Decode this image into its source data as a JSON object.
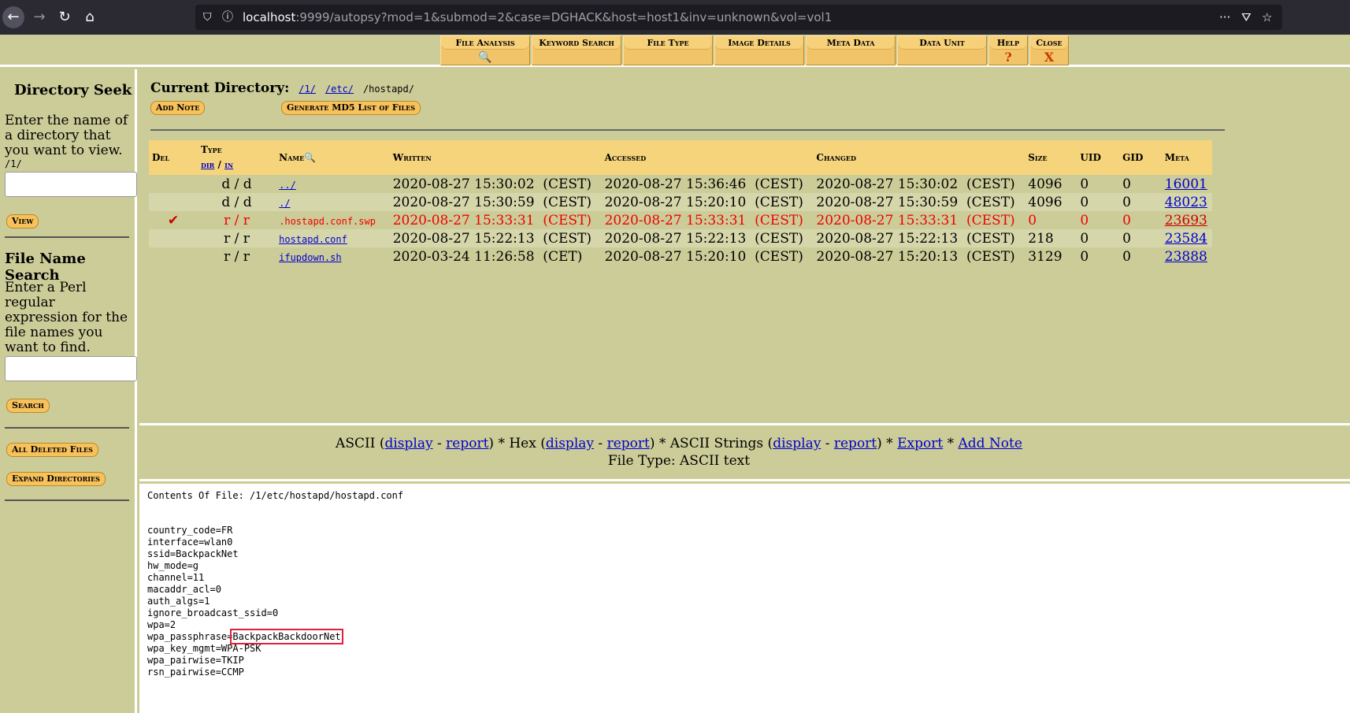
{
  "browser": {
    "url_host": "localhost",
    "url_rest": ":9999/autopsy?mod=1&submod=2&case=DGHACK&host=host1&inv=unknown&vol=vol1"
  },
  "menu": [
    {
      "label": "File Analysis",
      "sub": "🔍"
    },
    {
      "label": "Keyword Search",
      "sub": ""
    },
    {
      "label": "File Type",
      "sub": ""
    },
    {
      "label": "Image Details",
      "sub": ""
    },
    {
      "label": "Meta Data",
      "sub": ""
    },
    {
      "label": "Data Unit",
      "sub": ""
    },
    {
      "label": "Help",
      "sub": "?"
    },
    {
      "label": "Close",
      "sub": "X"
    }
  ],
  "sidebar": {
    "dir_seek_title": "Directory Seek",
    "dir_seek_text": "Enter the name of a directory that you want to view.",
    "dir_seek_path": "/1/",
    "view_label": "View",
    "file_search_title": "File Name Search",
    "file_search_text": "Enter a Perl regular expression for the file names you want to find.",
    "search_label": "Search",
    "all_deleted_label": "All Deleted Files",
    "expand_label": "Expand Directories"
  },
  "current_dir": {
    "label": "Current Directory:",
    "parts": [
      "/1/",
      "/etc/",
      "/hostapd/"
    ],
    "add_note_label": "Add Note",
    "md5_label": "Generate MD5 List of Files"
  },
  "table": {
    "headers": {
      "del": "Del",
      "type": "Type",
      "type_dir": "dir",
      "type_sep": "/",
      "type_in": "in",
      "name": "Name",
      "written": "Written",
      "accessed": "Accessed",
      "changed": "Changed",
      "size": "Size",
      "uid": "UID",
      "gid": "GID",
      "meta": "Meta"
    },
    "rows": [
      {
        "del": "",
        "type": "d / d",
        "name": "../",
        "written": "2020-08-27 15:30:02  (CEST)",
        "accessed": "2020-08-27 15:36:46  (CEST)",
        "changed": "2020-08-27 15:30:02  (CEST)",
        "size": "4096",
        "uid": "0",
        "gid": "0",
        "meta": "16001"
      },
      {
        "del": "",
        "type": "d / d",
        "name": "./",
        "written": "2020-08-27 15:30:59  (CEST)",
        "accessed": "2020-08-27 15:20:10  (CEST)",
        "changed": "2020-08-27 15:30:59  (CEST)",
        "size": "4096",
        "uid": "0",
        "gid": "0",
        "meta": "48023"
      },
      {
        "del": "✔",
        "type": "r / r",
        "name": ".hostapd.conf.swp",
        "written": "2020-08-27 15:33:31  (CEST)",
        "accessed": "2020-08-27 15:33:31  (CEST)",
        "changed": "2020-08-27 15:33:31  (CEST)",
        "size": "0",
        "uid": "0",
        "gid": "0",
        "meta": "23693"
      },
      {
        "del": "",
        "type": "r / r",
        "name": "hostapd.conf",
        "written": "2020-08-27 15:22:13  (CEST)",
        "accessed": "2020-08-27 15:22:13  (CEST)",
        "changed": "2020-08-27 15:22:13  (CEST)",
        "size": "218",
        "uid": "0",
        "gid": "0",
        "meta": "23584"
      },
      {
        "del": "",
        "type": "r / r",
        "name": "ifupdown.sh",
        "written": "2020-03-24 11:26:58  (CET)",
        "accessed": "2020-08-27 15:20:10  (CEST)",
        "changed": "2020-08-27 15:20:13  (CEST)",
        "size": "3129",
        "uid": "0",
        "gid": "0",
        "meta": "23888"
      }
    ]
  },
  "viewbar": {
    "ascii": "ASCII",
    "hex": "Hex",
    "ascii_strings": "ASCII Strings",
    "display": "display",
    "report": "report",
    "export": "Export",
    "add_note": "Add Note",
    "file_type": "File Type: ASCII text"
  },
  "contents": {
    "header": "Contents Of File: /1/etc/hostapd/hostapd.conf",
    "lines_before": "country_code=FR\ninterface=wlan0\nssid=BackpackNet\nhw_mode=g\nchannel=11\nmacaddr_acl=0\nauth_algs=1\nignore_broadcast_ssid=0\nwpa=2\nwpa_passphrase=",
    "highlight": "BackpackBackdoorNet",
    "lines_after": "\nwpa_key_mgmt=WPA-PSK\nwpa_pairwise=TKIP\nrsn_pairwise=CCMP"
  }
}
